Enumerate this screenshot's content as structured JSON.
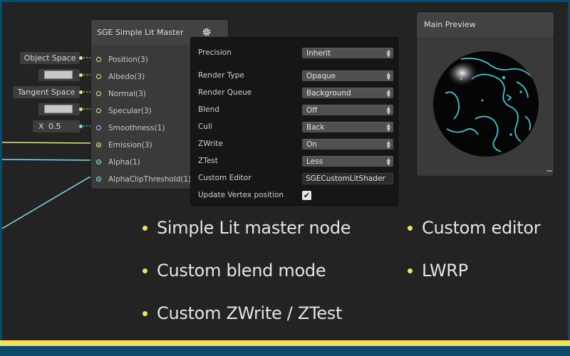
{
  "node": {
    "title": "SGE Simple Lit Master",
    "settings_icon": "gear-icon",
    "ports": [
      {
        "label": "Position(3)",
        "color": "#e8e88a"
      },
      {
        "label": "Albedo(3)",
        "color": "#e8e88a"
      },
      {
        "label": "Normal(3)",
        "color": "#e8e88a"
      },
      {
        "label": "Specular(3)",
        "color": "#e8e88a"
      },
      {
        "label": "Smoothness(1)",
        "color": "#86d9ec"
      },
      {
        "label": "Emission(3)",
        "color": "#e8e88a"
      },
      {
        "label": "Alpha(1)",
        "color": "#86d9ec"
      },
      {
        "label": "AlphaClipThreshold(1)",
        "color": "#86d9ec"
      }
    ]
  },
  "inputs": {
    "position": "Object Space",
    "normal": "Tangent Space",
    "smoothness_axis": "X",
    "smoothness_value": "0.5"
  },
  "settings": {
    "precision": {
      "label": "Precision",
      "value": "Inherit"
    },
    "render_type": {
      "label": "Render Type",
      "value": "Opaque"
    },
    "render_queue": {
      "label": "Render Queue",
      "value": "Background"
    },
    "blend": {
      "label": "Blend",
      "value": "Off"
    },
    "cull": {
      "label": "Cull",
      "value": "Back"
    },
    "zwrite": {
      "label": "ZWrite",
      "value": "On"
    },
    "ztest": {
      "label": "ZTest",
      "value": "Less"
    },
    "custom_editor": {
      "label": "Custom Editor",
      "value": "SGECustomLitShader"
    },
    "update_vertex": {
      "label": "Update Vertex position",
      "checked": true,
      "check_glyph": "✔"
    }
  },
  "preview": {
    "title": "Main Preview"
  },
  "bullets": [
    "Simple Lit master node",
    "Custom blend mode",
    "Custom ZWrite / ZTest",
    "Custom editor",
    "LWRP"
  ],
  "colors": {
    "accent_yellow": "#f2e15f",
    "frame_teal": "#0d4a6a",
    "port_vector": "#e8e88a",
    "port_scalar": "#86d9ec",
    "background": "#232323"
  }
}
